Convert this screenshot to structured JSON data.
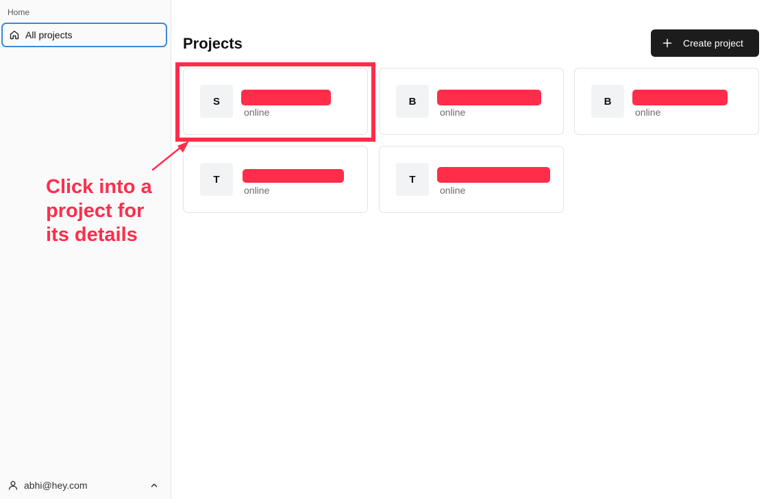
{
  "sidebar": {
    "section_label": "Home",
    "nav_items": [
      {
        "label": "All projects",
        "icon": "home-icon",
        "active": true
      }
    ],
    "user": {
      "email": "abhi@hey.com",
      "icon": "user-icon",
      "toggle_icon": "chevron-up-icon"
    }
  },
  "main": {
    "title": "Projects",
    "create_button": {
      "label": "Create project",
      "icon": "plus-icon"
    },
    "projects": [
      {
        "initial": "S",
        "name": "",
        "name_redacted": true,
        "status": "online"
      },
      {
        "initial": "B",
        "name": "",
        "name_redacted": true,
        "status": "online"
      },
      {
        "initial": "B",
        "name": "",
        "name_redacted": true,
        "status": "online"
      },
      {
        "initial": "T",
        "name": "",
        "name_redacted": true,
        "status": "online"
      },
      {
        "initial": "T",
        "name": "",
        "name_redacted": true,
        "status": "online"
      }
    ]
  },
  "annotation": {
    "text_lines": [
      "Click into a",
      "project for",
      "its details"
    ],
    "color": "#ff2d4a"
  },
  "colors": {
    "accent_focus": "#3b87d9",
    "button_bg": "#1c1c1c",
    "redaction": "#ff2d4a"
  }
}
